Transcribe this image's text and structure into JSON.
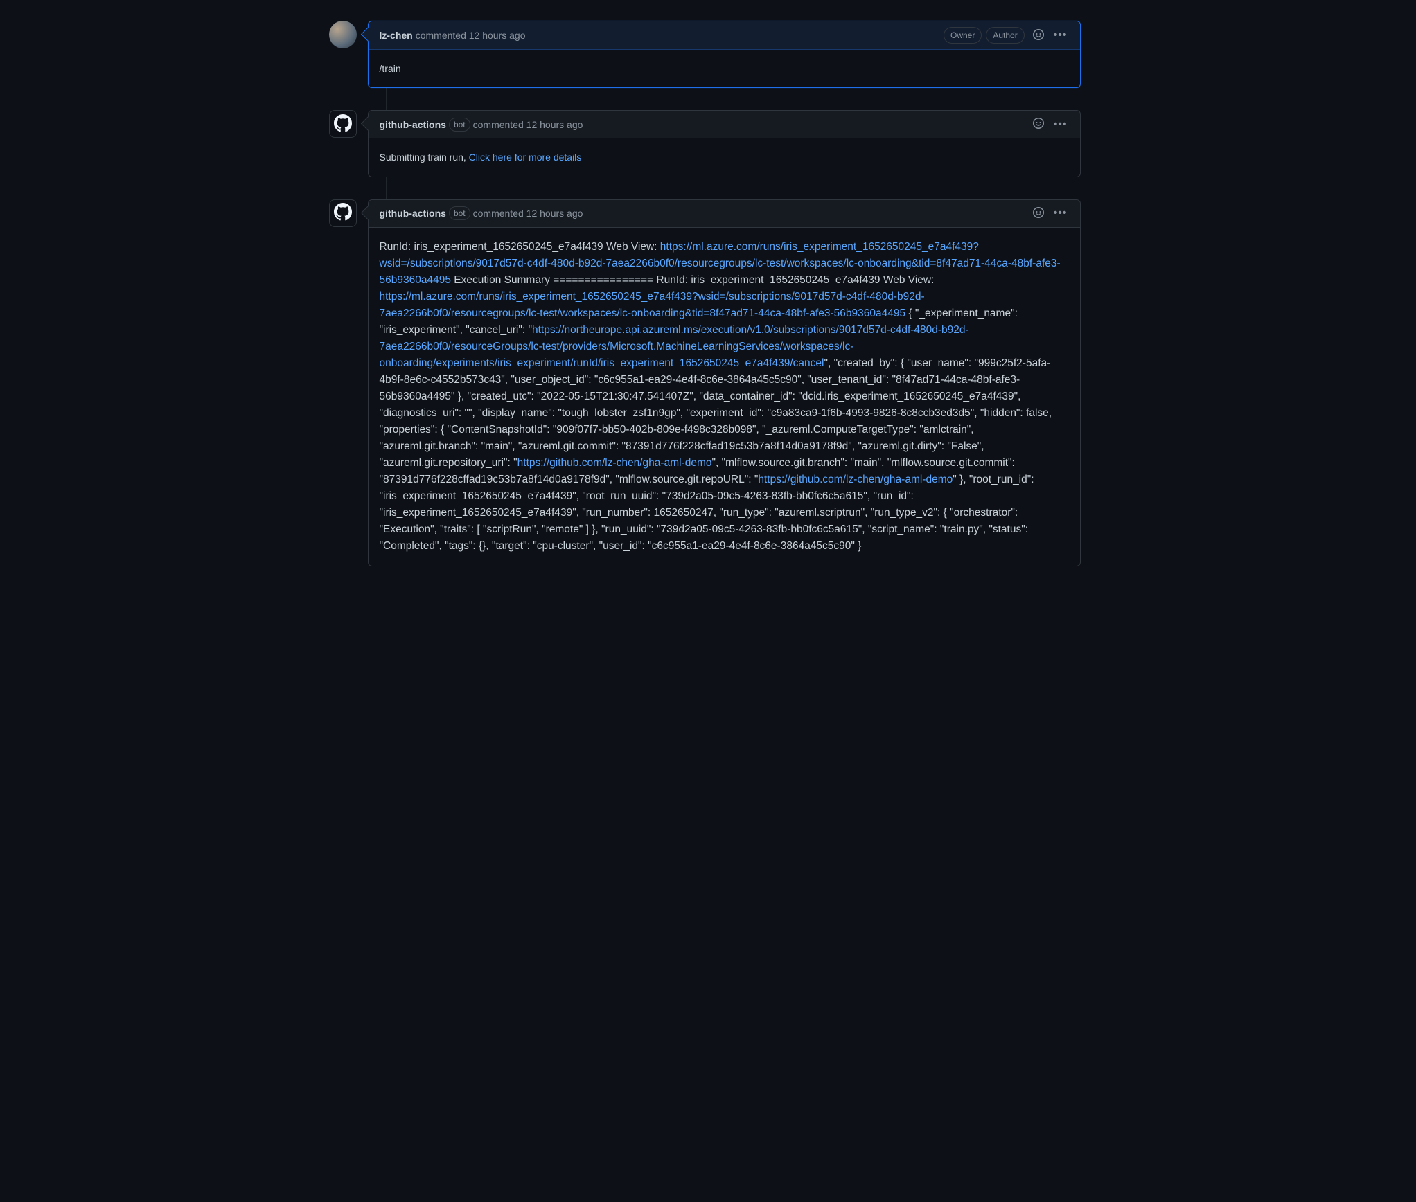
{
  "comments": [
    {
      "author": "lz-chen",
      "is_bot": false,
      "meta": "commented 12 hours ago",
      "badges": [
        "Owner",
        "Author"
      ],
      "body_plain": "/train",
      "highlighted": true
    },
    {
      "author": "github-actions",
      "is_bot": true,
      "bot_label": "bot",
      "meta": "commented 12 hours ago",
      "badges": [],
      "body_prefix": "Submitting train run, ",
      "body_link_text": "Click here for more details",
      "highlighted": false
    },
    {
      "author": "github-actions",
      "is_bot": true,
      "bot_label": "bot",
      "meta": "commented 12 hours ago",
      "badges": [],
      "highlighted": false,
      "run_body": {
        "t1": "RunId: iris_experiment_1652650245_e7a4f439 Web View: ",
        "link1": "https://ml.azure.com/runs/iris_experiment_1652650245_e7a4f439?wsid=/subscriptions/9017d57d-c4df-480d-b92d-7aea2266b0f0/resourcegroups/lc-test/workspaces/lc-onboarding&tid=8f47ad71-44ca-48bf-afe3-56b9360a4495",
        "t2": " Execution Summary ================ RunId: iris_experiment_1652650245_e7a4f439 Web View: ",
        "link2": "https://ml.azure.com/runs/iris_experiment_1652650245_e7a4f439?wsid=/subscriptions/9017d57d-c4df-480d-b92d-7aea2266b0f0/resourcegroups/lc-test/workspaces/lc-onboarding&tid=8f47ad71-44ca-48bf-afe3-56b9360a4495",
        "t3": " { \"_experiment_name\": \"iris_experiment\", \"cancel_uri\": \"",
        "link3": "https://northeurope.api.azureml.ms/execution/v1.0/subscriptions/9017d57d-c4df-480d-b92d-7aea2266b0f0/resourceGroups/lc-test/providers/Microsoft.MachineLearningServices/workspaces/lc-onboarding/experiments/iris_experiment/runId/iris_experiment_1652650245_e7a4f439/cancel",
        "t4": "\", \"created_by\": { \"user_name\": \"999c25f2-5afa-4b9f-8e6c-c4552b573c43\", \"user_object_id\": \"c6c955a1-ea29-4e4f-8c6e-3864a45c5c90\", \"user_tenant_id\": \"8f47ad71-44ca-48bf-afe3-56b9360a4495\" }, \"created_utc\": \"2022-05-15T21:30:47.541407Z\", \"data_container_id\": \"dcid.iris_experiment_1652650245_e7a4f439\", \"diagnostics_uri\": \"\", \"display_name\": \"tough_lobster_zsf1n9gp\", \"experiment_id\": \"c9a83ca9-1f6b-4993-9826-8c8ccb3ed3d5\", \"hidden\": false, \"properties\": { \"ContentSnapshotId\": \"909f07f7-bb50-402b-809e-f498c328b098\", \"_azureml.ComputeTargetType\": \"amlctrain\", \"azureml.git.branch\": \"main\", \"azureml.git.commit\": \"87391d776f228cffad19c53b7a8f14d0a9178f9d\", \"azureml.git.dirty\": \"False\", \"azureml.git.repository_uri\": \"",
        "link4": "https://github.com/lz-chen/gha-aml-demo",
        "t5": "\", \"mlflow.source.git.branch\": \"main\", \"mlflow.source.git.commit\": \"87391d776f228cffad19c53b7a8f14d0a9178f9d\", \"mlflow.source.git.repoURL\": \"",
        "link5": "https://github.com/lz-chen/gha-aml-demo",
        "t6": "\" }, \"root_run_id\": \"iris_experiment_1652650245_e7a4f439\", \"root_run_uuid\": \"739d2a05-09c5-4263-83fb-bb0fc6c5a615\", \"run_id\": \"iris_experiment_1652650245_e7a4f439\", \"run_number\": 1652650247, \"run_type\": \"azureml.scriptrun\", \"run_type_v2\": { \"orchestrator\": \"Execution\", \"traits\": [ \"scriptRun\", \"remote\" ] }, \"run_uuid\": \"739d2a05-09c5-4263-83fb-bb0fc6c5a615\", \"script_name\": \"train.py\", \"status\": \"Completed\", \"tags\": {}, \"target\": \"cpu-cluster\", \"user_id\": \"c6c955a1-ea29-4e4f-8c6e-3864a45c5c90\" }"
      }
    }
  ]
}
